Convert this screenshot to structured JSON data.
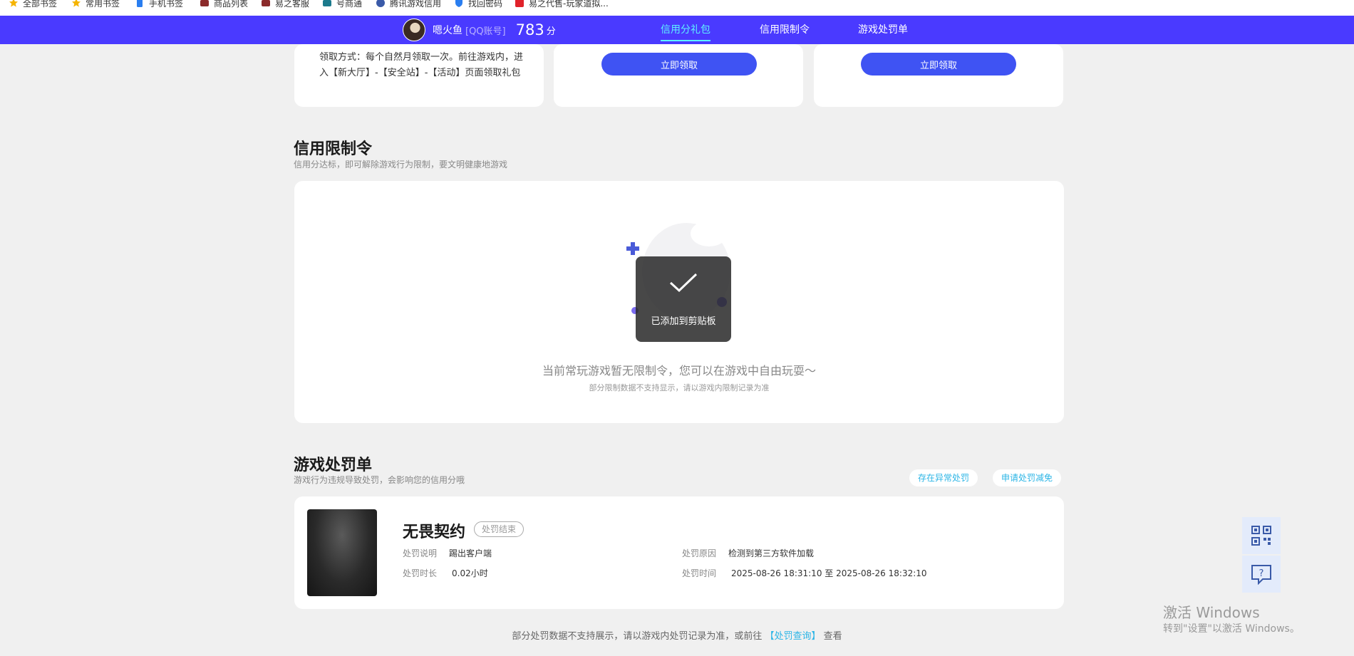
{
  "bookmarks": [
    {
      "label": "全部书签",
      "icon": "star-icon",
      "color": "#f5b400"
    },
    {
      "label": "常用书签",
      "icon": "star-icon",
      "color": "#f5b400"
    },
    {
      "label": "手机书签",
      "icon": "phone-icon",
      "color": "#2a7ef0"
    },
    {
      "label": "商品列表",
      "icon": "site-icon",
      "color": "#8b2a2a"
    },
    {
      "label": "易之客服",
      "icon": "site-icon",
      "color": "#8b2a2a"
    },
    {
      "label": "号商通",
      "icon": "site-icon",
      "color": "#1c7a8c"
    },
    {
      "label": "腾讯游戏信用",
      "icon": "site-icon",
      "color": "#3a5aa8"
    },
    {
      "label": "找回密码",
      "icon": "shield-icon",
      "color": "#2a7ef0"
    },
    {
      "label": "易之代售-玩家道拟...",
      "icon": "site-icon",
      "color": "#e0222a"
    }
  ],
  "user": {
    "name": "嗯火鱼",
    "account_type": "[QQ账号]",
    "score": "783",
    "score_unit": "分"
  },
  "nav_tabs": [
    {
      "label": "信用分礼包",
      "active": true
    },
    {
      "label": "信用限制令",
      "active": false
    },
    {
      "label": "游戏处罚单",
      "active": false
    }
  ],
  "gift": {
    "desc": "领取方式：每个自然月领取一次。前往游戏内，进入【新大厅】-【安全站】-【活动】页面领取礼包",
    "claim_label": "立即领取"
  },
  "restriction": {
    "title": "信用限制令",
    "subtitle": "信用分达标，即可解除游戏行为限制，要文明健康地游戏",
    "empty_main": "当前常玩游戏暂无限制令，您可以在游戏中自由玩耍～",
    "empty_sub": "部分限制数据不支持显示，请以游戏内限制记录为准"
  },
  "toast": {
    "text": "已添加到剪贴板"
  },
  "penalty": {
    "title": "游戏处罚单",
    "subtitle": "游戏行为违规导致处罚，会影响您的信用分哦",
    "btn_abnormal": "存在异常处罚",
    "btn_reduce": "申请处罚减免",
    "game": "无畏契约",
    "status": "处罚结束",
    "desc_label": "处罚说明",
    "desc_value": "踢出客户端",
    "duration_label": "处罚时长",
    "duration_value": "0.02小时",
    "reason_label": "处罚原因",
    "reason_value": "检测到第三方软件加载",
    "time_label": "处罚时间",
    "time_value": "2025-08-26 18:31:10 至 2025-08-26 18:32:10"
  },
  "footer": {
    "prefix": "部分处罚数据不支持展示，请以游戏内处罚记录为准，或前往",
    "link": "【处罚查询】",
    "suffix": "查看"
  },
  "watermark": {
    "line1": "激活 Windows",
    "line2": "转到\"设置\"以激活 Windows。"
  },
  "colors": {
    "nav": "#4a3aff",
    "button": "#3f53f3",
    "accent": "#2bb5e6",
    "active_tab": "#5ef2ff"
  }
}
